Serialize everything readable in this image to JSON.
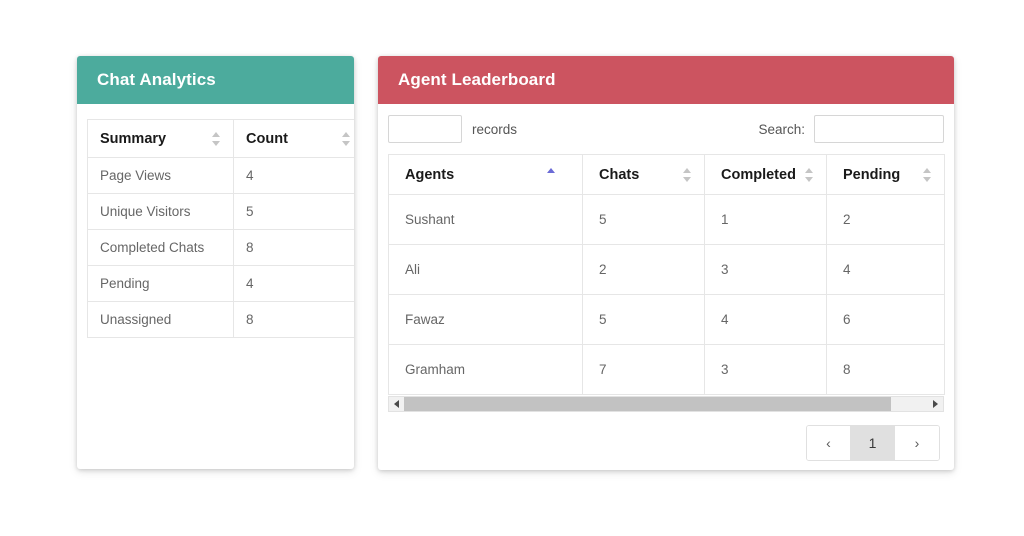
{
  "analytics": {
    "title": "Chat Analytics",
    "accent_color": "#4CAB9D",
    "columns": [
      {
        "label": "Summary",
        "sort": "none"
      },
      {
        "label": "Count",
        "sort": "none"
      }
    ],
    "rows": [
      {
        "summary": "Page Views",
        "count": "4"
      },
      {
        "summary": "Unique Visitors",
        "count": "5"
      },
      {
        "summary": "Completed Chats",
        "count": "8"
      },
      {
        "summary": "Pending",
        "count": "4"
      },
      {
        "summary": "Unassigned",
        "count": "8"
      }
    ]
  },
  "leaderboard": {
    "title": "Agent Leaderboard",
    "accent_color": "#CC5460",
    "length_select": {
      "value": "",
      "placeholder": "",
      "suffix_label": "records"
    },
    "search": {
      "label": "Search:",
      "value": "",
      "placeholder": ""
    },
    "columns": [
      {
        "label": "Agents",
        "sort": "asc",
        "sort_color": "#6b6bd6"
      },
      {
        "label": "Chats",
        "sort": "none"
      },
      {
        "label": "Completed",
        "sort": "none"
      },
      {
        "label": "Pending",
        "sort": "none"
      }
    ],
    "rows": [
      {
        "agent": "Sushant",
        "chats": "5",
        "completed": "1",
        "pending": "2"
      },
      {
        "agent": "Ali",
        "chats": "2",
        "completed": "3",
        "pending": "4"
      },
      {
        "agent": "Fawaz",
        "chats": "5",
        "completed": "4",
        "pending": "6"
      },
      {
        "agent": "Gramham",
        "chats": "7",
        "completed": "3",
        "pending": "8"
      }
    ],
    "scrollbar": {
      "left_arrow": "left-arrow-icon",
      "right_arrow": "right-arrow-icon",
      "thumb_percent": 93
    },
    "pagination": {
      "previous_label": "‹",
      "next_label": "›",
      "pages": [
        "1"
      ],
      "active_page": "1"
    }
  }
}
